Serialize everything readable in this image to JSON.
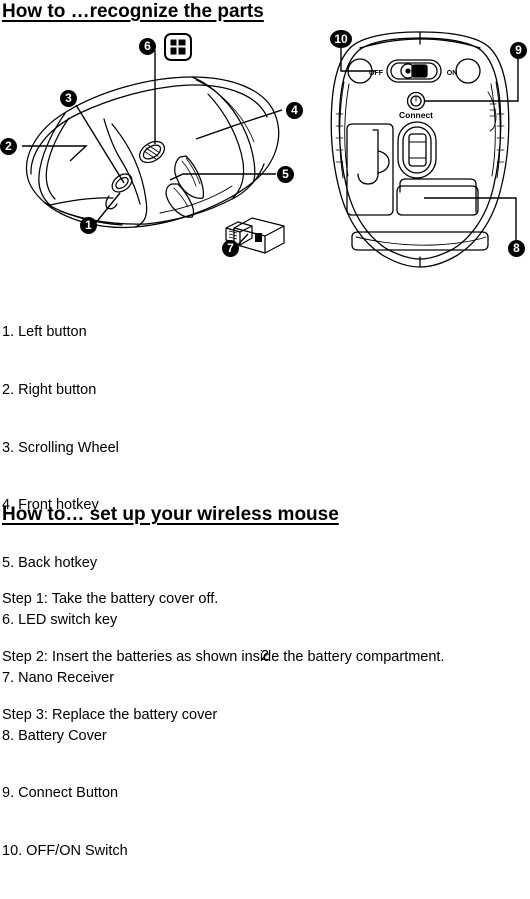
{
  "document": {
    "page_number": "2"
  },
  "sections": {
    "parts": {
      "heading": "How to …recognize the parts",
      "list": [
        "1. Left button",
        "2. Right button",
        "3. Scrolling Wheel",
        "4. Front hotkey",
        "5. Back hotkey",
        "6. LED switch key",
        "7. Nano Receiver",
        "8. Battery Cover",
        "9. Connect Button",
        "10. OFF/ON Switch"
      ]
    },
    "setup": {
      "heading": "How to… set up your wireless mouse",
      "steps": [
        "Step 1: Take the battery cover off.",
        "Step 2: Insert the batteries as shown inside the battery compartment.",
        "Step 3: Replace the battery cover"
      ]
    }
  },
  "figures": {
    "top_view": {
      "callouts": [
        {
          "id": "1",
          "label": "1"
        },
        {
          "id": "2",
          "label": "2"
        },
        {
          "id": "3",
          "label": "3"
        },
        {
          "id": "4",
          "label": "4"
        },
        {
          "id": "5",
          "label": "5"
        },
        {
          "id": "6",
          "label": "6"
        },
        {
          "id": "7",
          "label": "7"
        }
      ],
      "windows_badge": "windows-logo"
    },
    "bottom_view": {
      "callouts": [
        {
          "id": "8",
          "label": "8"
        },
        {
          "id": "9",
          "label": "9"
        },
        {
          "id": "10",
          "label": "10"
        }
      ],
      "labels": {
        "switch_off": "OFF",
        "switch_on": "ON",
        "connect": "Connect"
      }
    }
  },
  "colors": {
    "ink": "#000000",
    "paper": "#ffffff"
  }
}
